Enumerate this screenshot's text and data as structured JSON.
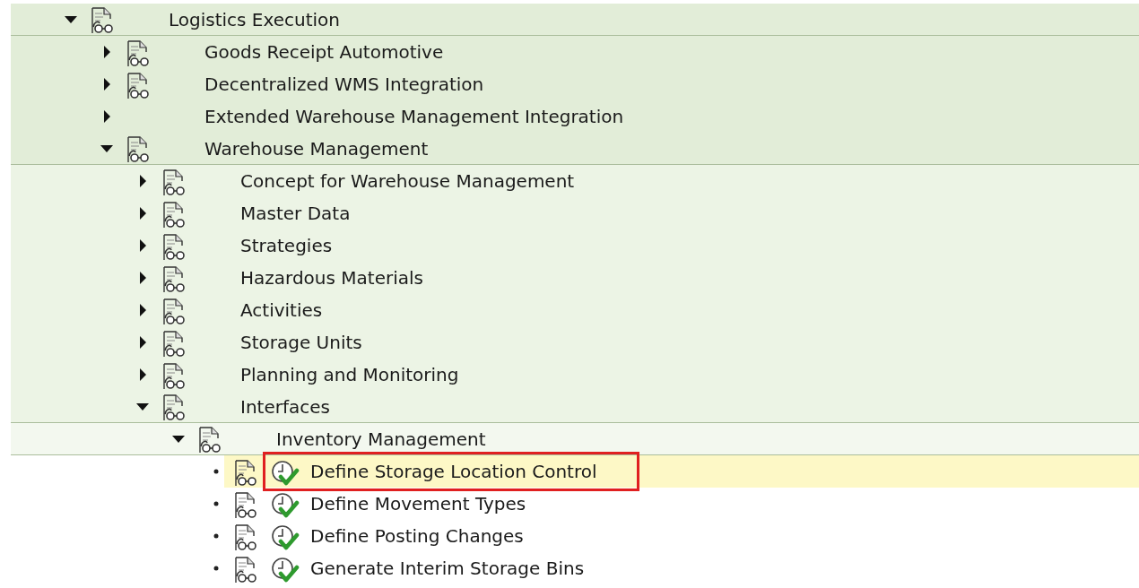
{
  "tree": [
    {
      "label": "Logistics Execution",
      "documented": true,
      "expanded": true,
      "children": [
        {
          "label": "Goods Receipt Automotive",
          "documented": true,
          "expanded": false
        },
        {
          "label": "Decentralized WMS Integration",
          "documented": true,
          "expanded": false
        },
        {
          "label": "Extended Warehouse Management Integration",
          "documented": false,
          "expanded": false
        },
        {
          "label": "Warehouse Management",
          "documented": true,
          "expanded": true,
          "children": [
            {
              "label": "Concept for Warehouse Management",
              "documented": true,
              "expanded": false
            },
            {
              "label": "Master Data",
              "documented": true,
              "expanded": false
            },
            {
              "label": "Strategies",
              "documented": true,
              "expanded": false
            },
            {
              "label": "Hazardous Materials",
              "documented": true,
              "expanded": false
            },
            {
              "label": "Activities",
              "documented": true,
              "expanded": false
            },
            {
              "label": "Storage Units",
              "documented": true,
              "expanded": false
            },
            {
              "label": "Planning and Monitoring",
              "documented": true,
              "expanded": false
            },
            {
              "label": "Interfaces",
              "documented": true,
              "expanded": true,
              "children": [
                {
                  "label": "Inventory Management",
                  "documented": true,
                  "expanded": true,
                  "children": [
                    {
                      "kind": "activity",
                      "label": "Define Storage Location Control",
                      "documented": true,
                      "selected": true,
                      "highlighted": true
                    },
                    {
                      "kind": "activity",
                      "label": "Define Movement Types",
                      "documented": true,
                      "selected": false,
                      "highlighted": false
                    },
                    {
                      "kind": "activity",
                      "label": "Define Posting Changes",
                      "documented": true,
                      "selected": false,
                      "highlighted": false
                    },
                    {
                      "kind": "activity",
                      "label": "Generate Interim Storage Bins",
                      "documented": true,
                      "selected": false,
                      "highlighted": false
                    }
                  ]
                }
              ]
            }
          ]
        }
      ]
    }
  ]
}
